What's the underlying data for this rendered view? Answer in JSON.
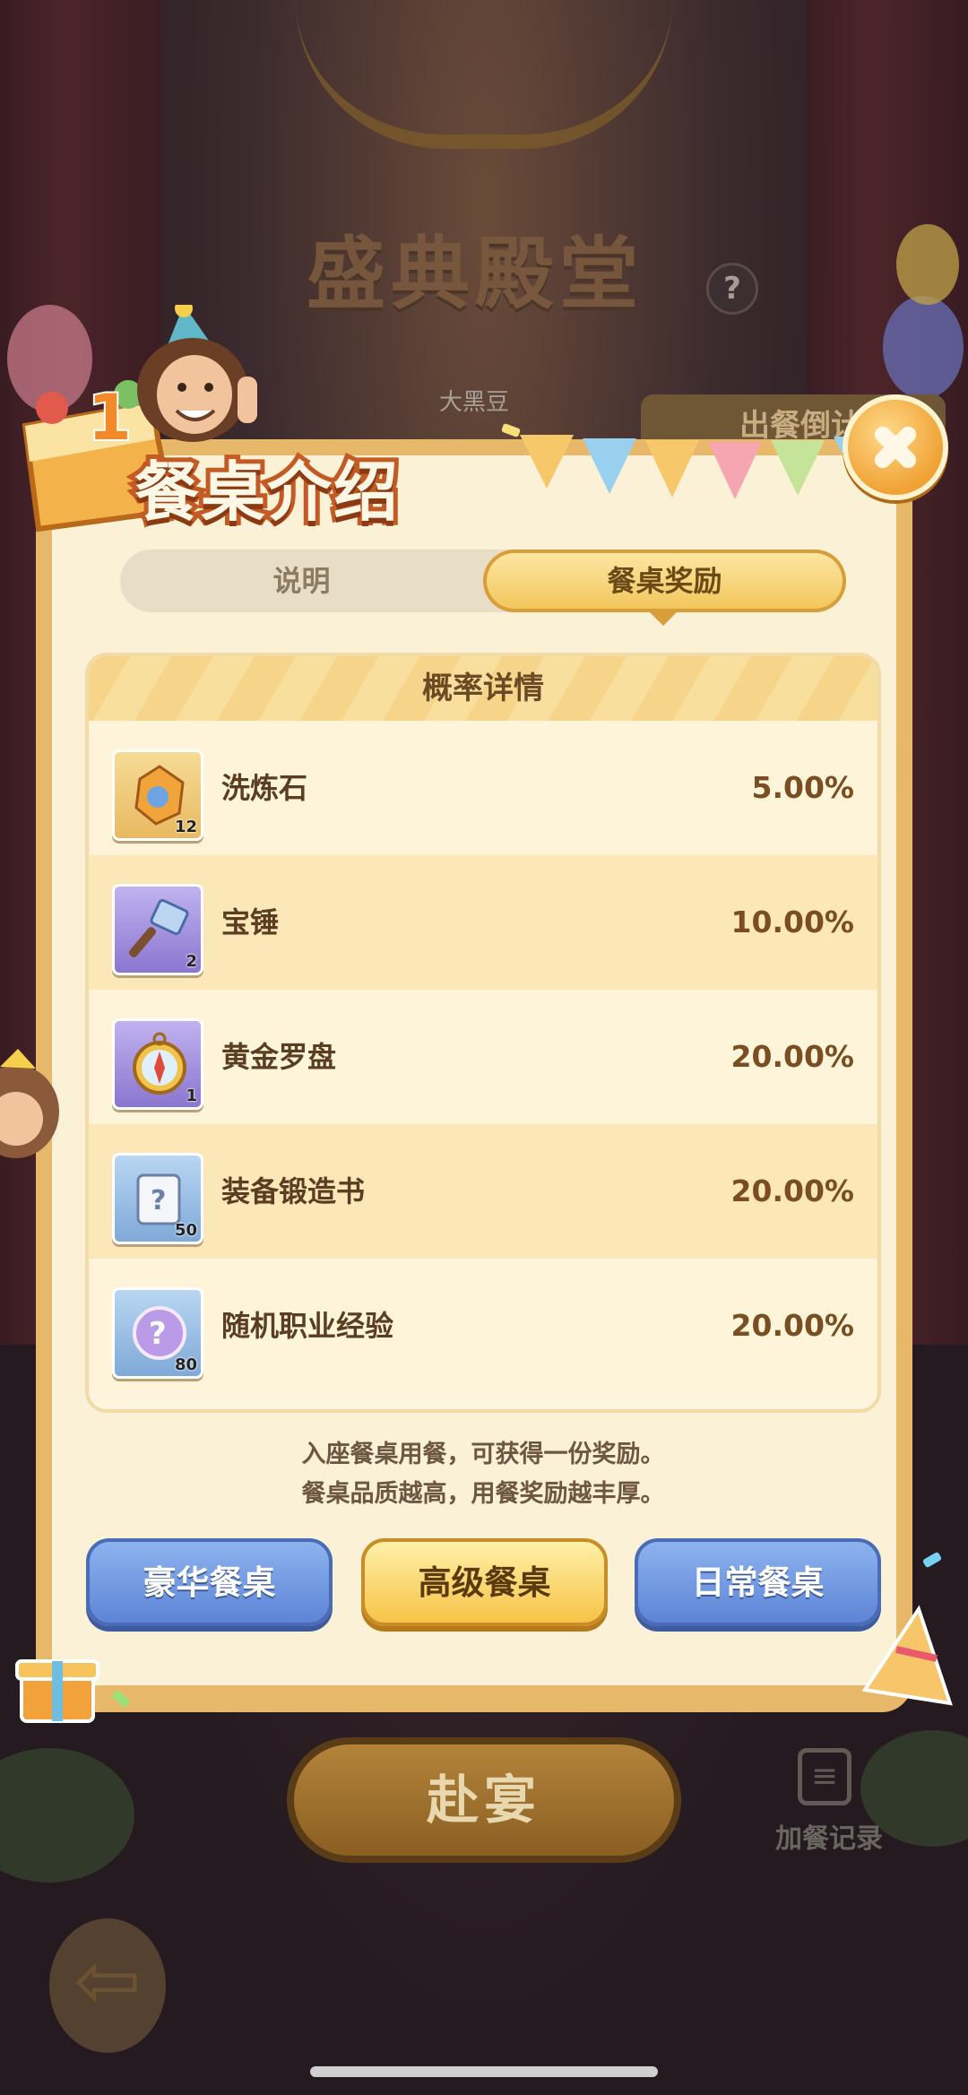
{
  "background": {
    "hall_title": "盛典殿堂",
    "help_badge": "?",
    "user_name": "大黑豆",
    "serve_countdown": "出餐倒计",
    "feast_button": "赴宴",
    "extra_record_label": "加餐记录",
    "extra_record_icon": "clipboard-icon",
    "back_icon": "arrow-left-icon"
  },
  "modal": {
    "title": "餐桌介绍",
    "emblem_number": "1",
    "close_icon": "close-icon",
    "tabs": [
      {
        "label": "说明",
        "active": false
      },
      {
        "label": "餐桌奖励",
        "active": true
      }
    ],
    "probability": {
      "header": "概率详情",
      "items": [
        {
          "name": "洗炼石",
          "count": "12",
          "prob": "5.00%",
          "icon": "refine-stone-icon",
          "frame": "gold"
        },
        {
          "name": "宝锤",
          "count": "2",
          "prob": "10.00%",
          "icon": "hammer-icon",
          "frame": "purple"
        },
        {
          "name": "黄金罗盘",
          "count": "1",
          "prob": "20.00%",
          "icon": "compass-icon",
          "frame": "purple"
        },
        {
          "name": "装备锻造书",
          "count": "50",
          "prob": "20.00%",
          "icon": "scroll-icon",
          "frame": "blue"
        },
        {
          "name": "随机职业经验",
          "count": "80",
          "prob": "20.00%",
          "icon": "question-orb-icon",
          "frame": "blue"
        }
      ]
    },
    "notes": [
      "入座餐桌用餐，可获得一份奖励。",
      "餐桌品质越高，用餐奖励越丰厚。"
    ],
    "table_buttons": [
      {
        "label": "豪华餐桌",
        "selected": false
      },
      {
        "label": "高级餐桌",
        "selected": true
      },
      {
        "label": "日常餐桌",
        "selected": false
      }
    ]
  },
  "colors": {
    "accent_gold": "#f2c458",
    "title_stroke": "#c45a24",
    "button_blue": "#5d84d6"
  }
}
